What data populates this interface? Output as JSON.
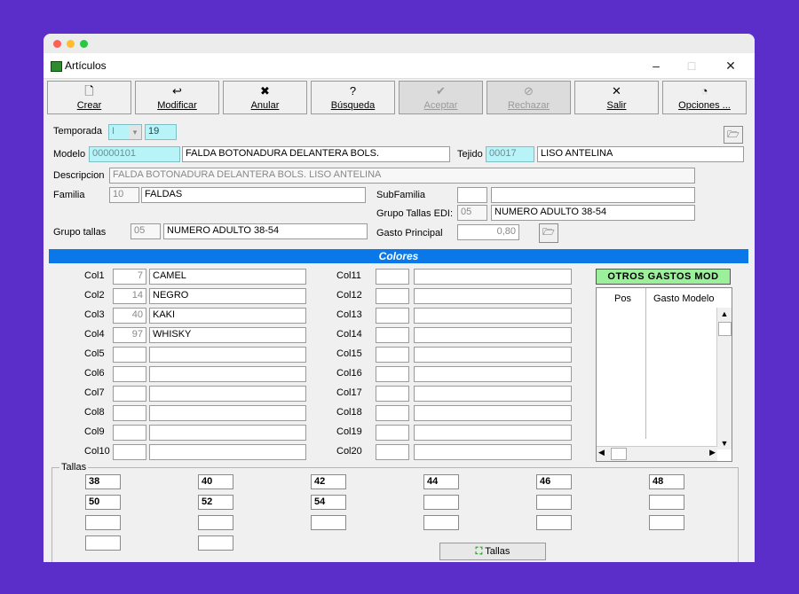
{
  "window": {
    "title": "Artículos"
  },
  "toolbar": [
    {
      "label": "Crear",
      "icon": "new-document-icon",
      "glyph": "🗋",
      "disabled": false
    },
    {
      "label": "Modificar",
      "icon": "undo-arrow-icon",
      "glyph": "↩",
      "disabled": false
    },
    {
      "label": "Anular",
      "icon": "red-x-icon",
      "glyph": "✖",
      "disabled": false
    },
    {
      "label": "Búsqueda",
      "icon": "question-icon",
      "glyph": "?",
      "disabled": false
    },
    {
      "label": "Aceptar",
      "icon": "checkmark-icon",
      "glyph": "✔",
      "disabled": true
    },
    {
      "label": "Rechazar",
      "icon": "no-entry-icon",
      "glyph": "⊘",
      "disabled": true
    },
    {
      "label": "Salir",
      "icon": "close-x-icon",
      "glyph": "✕",
      "disabled": false
    },
    {
      "label": "Opciones ...",
      "icon": "options-icon",
      "glyph": "◔",
      "disabled": false
    }
  ],
  "form": {
    "temporada_label": "Temporada",
    "temporada_code": "I",
    "temporada_year": "19",
    "modelo_label": "Modelo",
    "modelo_code": "00000101",
    "modelo_desc": "FALDA BOTONADURA DELANTERA BOLS.",
    "tejido_label": "Tejido",
    "tejido_code": "00017",
    "tejido_desc": "LISO ANTELINA",
    "descripcion_label": "Descripcion",
    "descripcion_value": "FALDA BOTONADURA DELANTERA BOLS. LISO ANTELINA",
    "familia_label": "Familia",
    "familia_code": "10",
    "familia_desc": "FALDAS",
    "subfamilia_label": "SubFamilia",
    "subfamilia_code": "",
    "subfamilia_desc": "",
    "grupo_edi_label": "Grupo Tallas EDI:",
    "grupo_edi_code": "05",
    "grupo_edi_desc": "NUMERO ADULTO 38-54",
    "grupo_tallas_label": "Grupo tallas",
    "grupo_tallas_code": "05",
    "grupo_tallas_desc": "NUMERO ADULTO 38-54",
    "gasto_label": "Gasto Principal",
    "gasto_value": "0,80"
  },
  "colores": {
    "title": "Colores",
    "left": [
      {
        "label": "Col1",
        "code": "7",
        "name": "CAMEL"
      },
      {
        "label": "Col2",
        "code": "14",
        "name": "NEGRO"
      },
      {
        "label": "Col3",
        "code": "40",
        "name": "KAKI"
      },
      {
        "label": "Col4",
        "code": "97",
        "name": "WHISKY"
      },
      {
        "label": "Col5",
        "code": "",
        "name": ""
      },
      {
        "label": "Col6",
        "code": "",
        "name": ""
      },
      {
        "label": "Col7",
        "code": "",
        "name": ""
      },
      {
        "label": "Col8",
        "code": "",
        "name": ""
      },
      {
        "label": "Col9",
        "code": "",
        "name": ""
      },
      {
        "label": "Col10",
        "code": "",
        "name": ""
      }
    ],
    "right": [
      {
        "label": "Col11",
        "code": "",
        "name": ""
      },
      {
        "label": "Col12",
        "code": "",
        "name": ""
      },
      {
        "label": "Col13",
        "code": "",
        "name": ""
      },
      {
        "label": "Col14",
        "code": "",
        "name": ""
      },
      {
        "label": "Col15",
        "code": "",
        "name": ""
      },
      {
        "label": "Col16",
        "code": "",
        "name": ""
      },
      {
        "label": "Col17",
        "code": "",
        "name": ""
      },
      {
        "label": "Col18",
        "code": "",
        "name": ""
      },
      {
        "label": "Col19",
        "code": "",
        "name": ""
      },
      {
        "label": "Col20",
        "code": "",
        "name": ""
      }
    ]
  },
  "otros": {
    "title": "OTROS GASTOS MOD",
    "col_pos": "Pos",
    "col_gasto": "Gasto Modelo"
  },
  "tallas": {
    "legend": "Tallas",
    "rows": [
      [
        "38",
        "40",
        "42",
        "44",
        "46",
        "48"
      ],
      [
        "50",
        "52",
        "54",
        "",
        "",
        ""
      ],
      [
        "",
        "",
        "",
        "",
        "",
        ""
      ],
      [
        "",
        ""
      ]
    ],
    "button_label": "Tallas"
  },
  "colors": {
    "accent_band": "#0a78e8",
    "highlight_field": "#b7f3f7",
    "otros_header": "#9cf09c"
  }
}
